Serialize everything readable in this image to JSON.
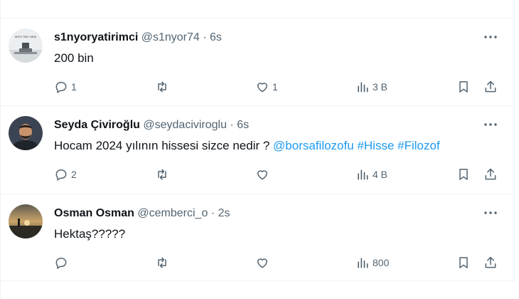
{
  "tweets": [
    {
      "name": "s1nyoryatirimci",
      "handle": "@s1nyor74",
      "time": "6s",
      "text": "200 bin",
      "avatar_text": "WITH THE VIEW",
      "replies": "1",
      "reposts": "",
      "likes": "1",
      "views": "3 B"
    },
    {
      "name": "Seyda Çiviroğlu",
      "handle": "@seydaciviroglu",
      "time": "6s",
      "text": "Hocam 2024 yılının hissesi sizce nedir ?",
      "mention": "@borsafilozofu",
      "hashtag1": "#Hisse",
      "hashtag2": "#Filozof",
      "replies": "2",
      "reposts": "",
      "likes": "",
      "views": "4 B"
    },
    {
      "name": "Osman Osman",
      "handle": "@cemberci_o",
      "time": "2s",
      "text": "Hektaş?????",
      "replies": "",
      "reposts": "",
      "likes": "",
      "views": "800"
    }
  ],
  "colors": {
    "text": "#0f1419",
    "secondary": "#536471",
    "link": "#1d9bf0",
    "border": "#eff3f4"
  },
  "icons": [
    "more-icon",
    "reply-icon",
    "repost-icon",
    "like-icon",
    "views-icon",
    "bookmark-icon",
    "share-icon"
  ]
}
